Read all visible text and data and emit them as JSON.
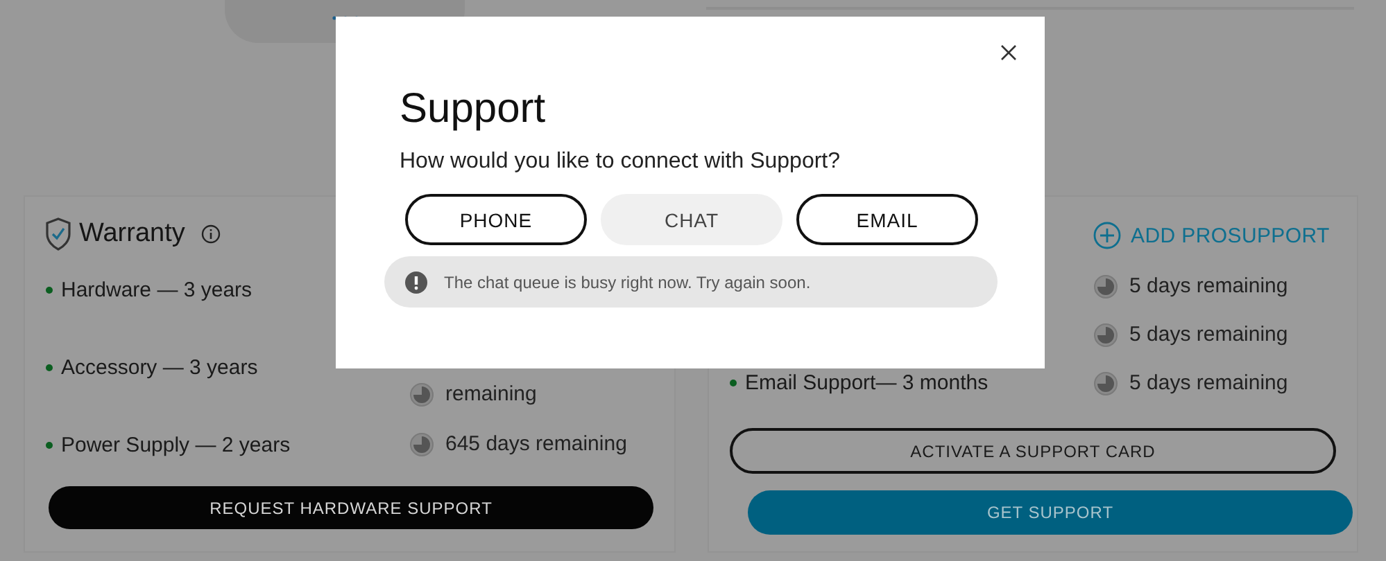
{
  "warranty_card": {
    "title": "Warranty",
    "items": [
      {
        "label": "Hardware — 3 years"
      },
      {
        "label": "Accessory — 3 years",
        "remaining": "remaining"
      },
      {
        "label": "Power Supply — 2 years",
        "remaining": "645 days remaining"
      }
    ],
    "button": "REQUEST HARDWARE SUPPORT"
  },
  "support_card": {
    "add_link": "ADD PROSUPPORT",
    "items": [
      {
        "remaining": "5 days remaining"
      },
      {
        "remaining": "5 days remaining"
      },
      {
        "label": "Email Support— 3 months",
        "remaining": "5 days remaining"
      }
    ],
    "buttons": [
      {
        "label": "ACTIVATE A SUPPORT CARD",
        "kind": "outline"
      },
      {
        "label": "GET SUPPORT",
        "kind": "primary"
      }
    ]
  },
  "dialog": {
    "title": "Support",
    "question": "How would you like to connect with Support?",
    "options": [
      {
        "label": "PHONE",
        "disabled": false
      },
      {
        "label": "CHAT",
        "disabled": true
      },
      {
        "label": "EMAIL",
        "disabled": false
      }
    ],
    "alert": "The chat queue is busy right now. Try again soon."
  }
}
